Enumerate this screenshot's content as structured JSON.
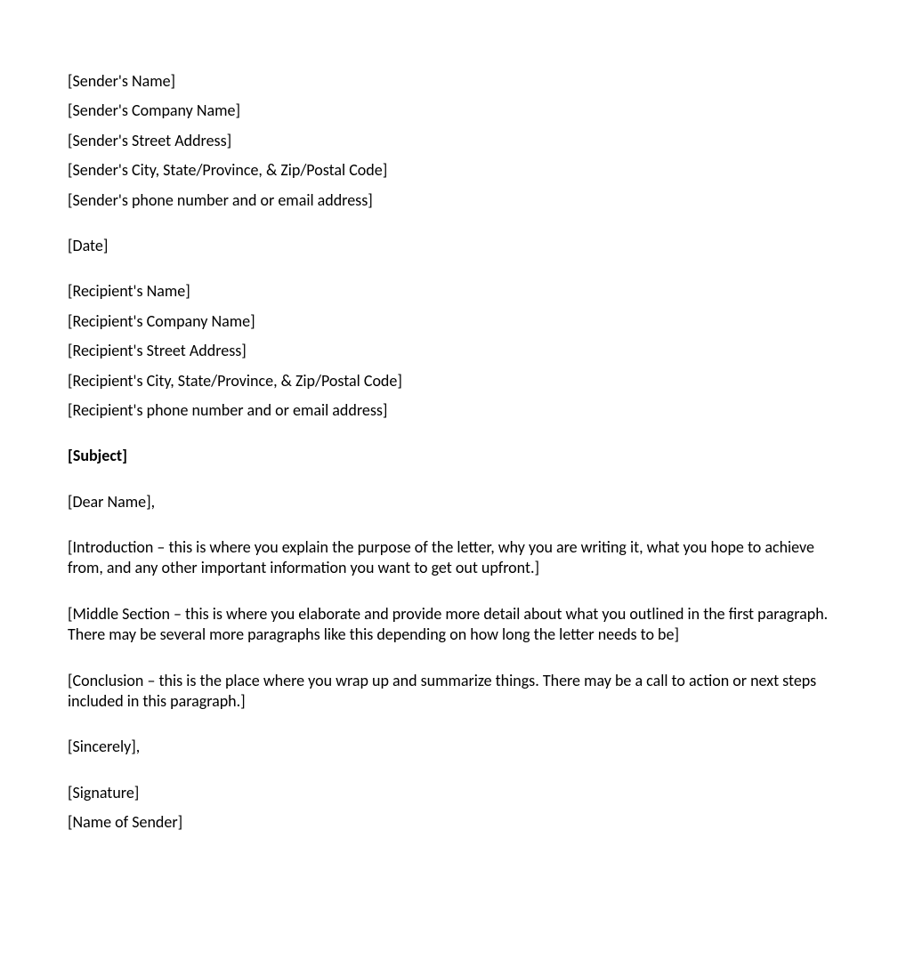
{
  "sender": {
    "name": "[Sender's Name]",
    "company": "[Sender's Company Name]",
    "street": "[Sender's Street Address]",
    "city_state_zip": "[Sender's City, State/Province, & Zip/Postal Code]",
    "contact": "[Sender's phone number and or email address]"
  },
  "date": "[Date]",
  "recipient": {
    "name": "[Recipient's Name]",
    "company": "[Recipient's Company Name]",
    "street": "[Recipient's Street Address]",
    "city_state_zip": "[Recipient's City, State/Province, & Zip/Postal Code]",
    "contact": "[Recipient's phone number and or email address]"
  },
  "subject": "[Subject]",
  "salutation": "[Dear Name],",
  "body": {
    "introduction": "[Introduction – this is where you explain the purpose of the letter, why you are writing it, what you hope to achieve from, and any other important information you want to get out upfront.]",
    "middle": "[Middle Section – this is where you elaborate and provide more detail about what you outlined in the first paragraph. There may be several more paragraphs like this depending on how long the letter needs to be]",
    "conclusion": "[Conclusion – this is the place where you wrap up and summarize things. There may be a call to action or next steps included in this paragraph.]"
  },
  "closing": "[Sincerely],",
  "signature": {
    "sig": "[Signature]",
    "name": "[Name of Sender]"
  }
}
